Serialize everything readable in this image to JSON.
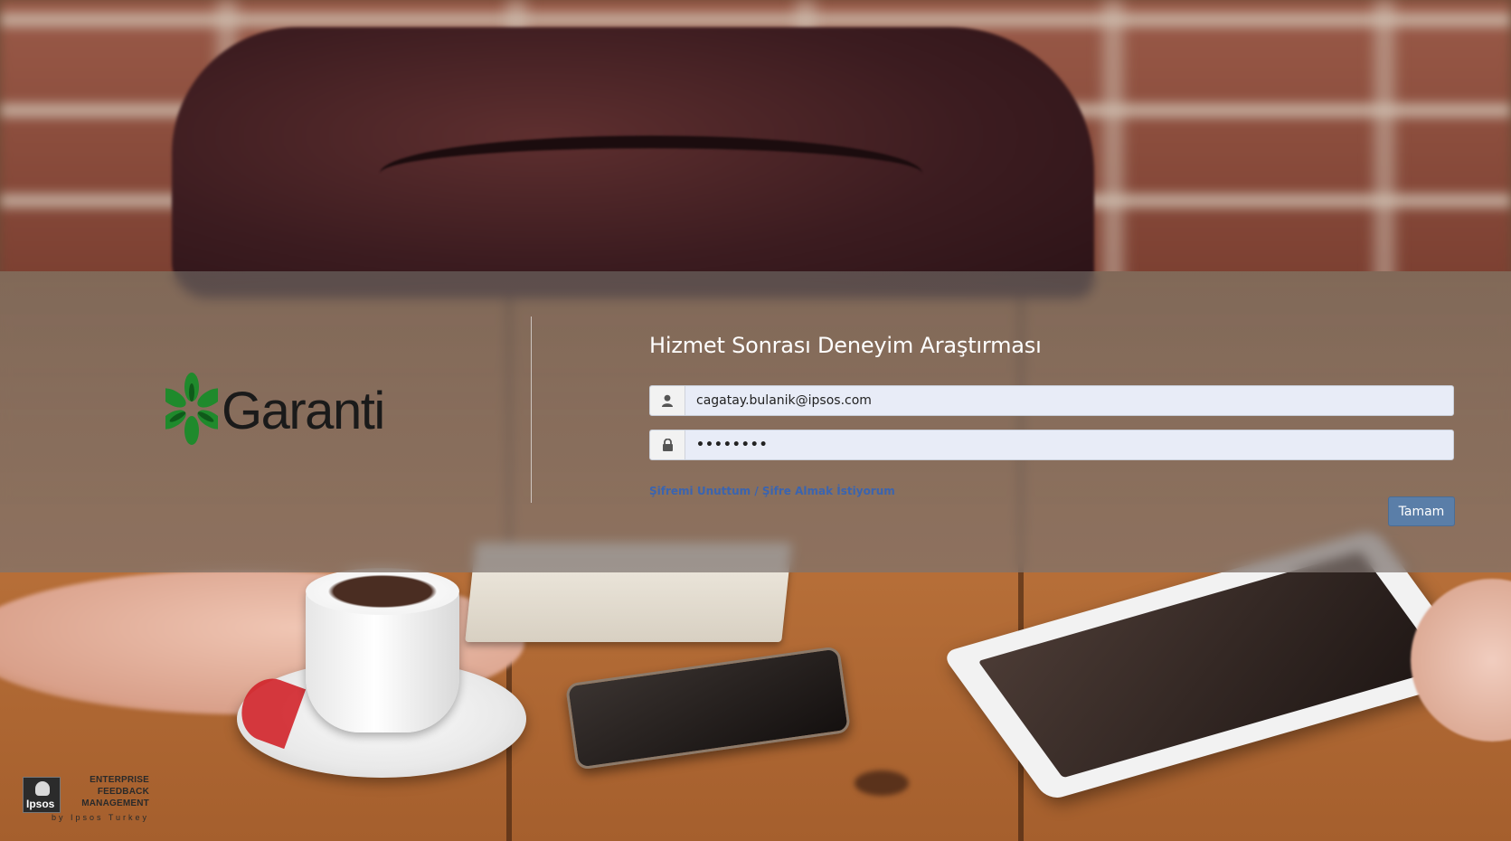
{
  "colors": {
    "band_overlay": "#766c68",
    "title_text": "#ffffff",
    "link": "#3a64b0",
    "button_bg": "#5a7ea8",
    "logo_green": "#1f8a2c",
    "logo_text": "#1a1a1a"
  },
  "brand": {
    "logo_text": "Garanti",
    "logo_icon": "clover-leaf-icon"
  },
  "login": {
    "title": "Hizmet Sonrası Deneyim Araştırması",
    "username": {
      "value": "cagatay.bulanik@ipsos.com",
      "icon": "user-icon"
    },
    "password": {
      "value": "••••••••",
      "icon": "lock-icon"
    },
    "forgot_link": "Şifremi Unuttum / Şifre Almak İstiyorum",
    "submit_label": "Tamam"
  },
  "footer": {
    "ipsos_logo_text": "Ipsos",
    "product_line_1": "ENTERPRISE",
    "product_line_2": "FEEDBACK",
    "product_line_3": "MANAGEMENT",
    "by_line": "by Ipsos Turkey"
  }
}
